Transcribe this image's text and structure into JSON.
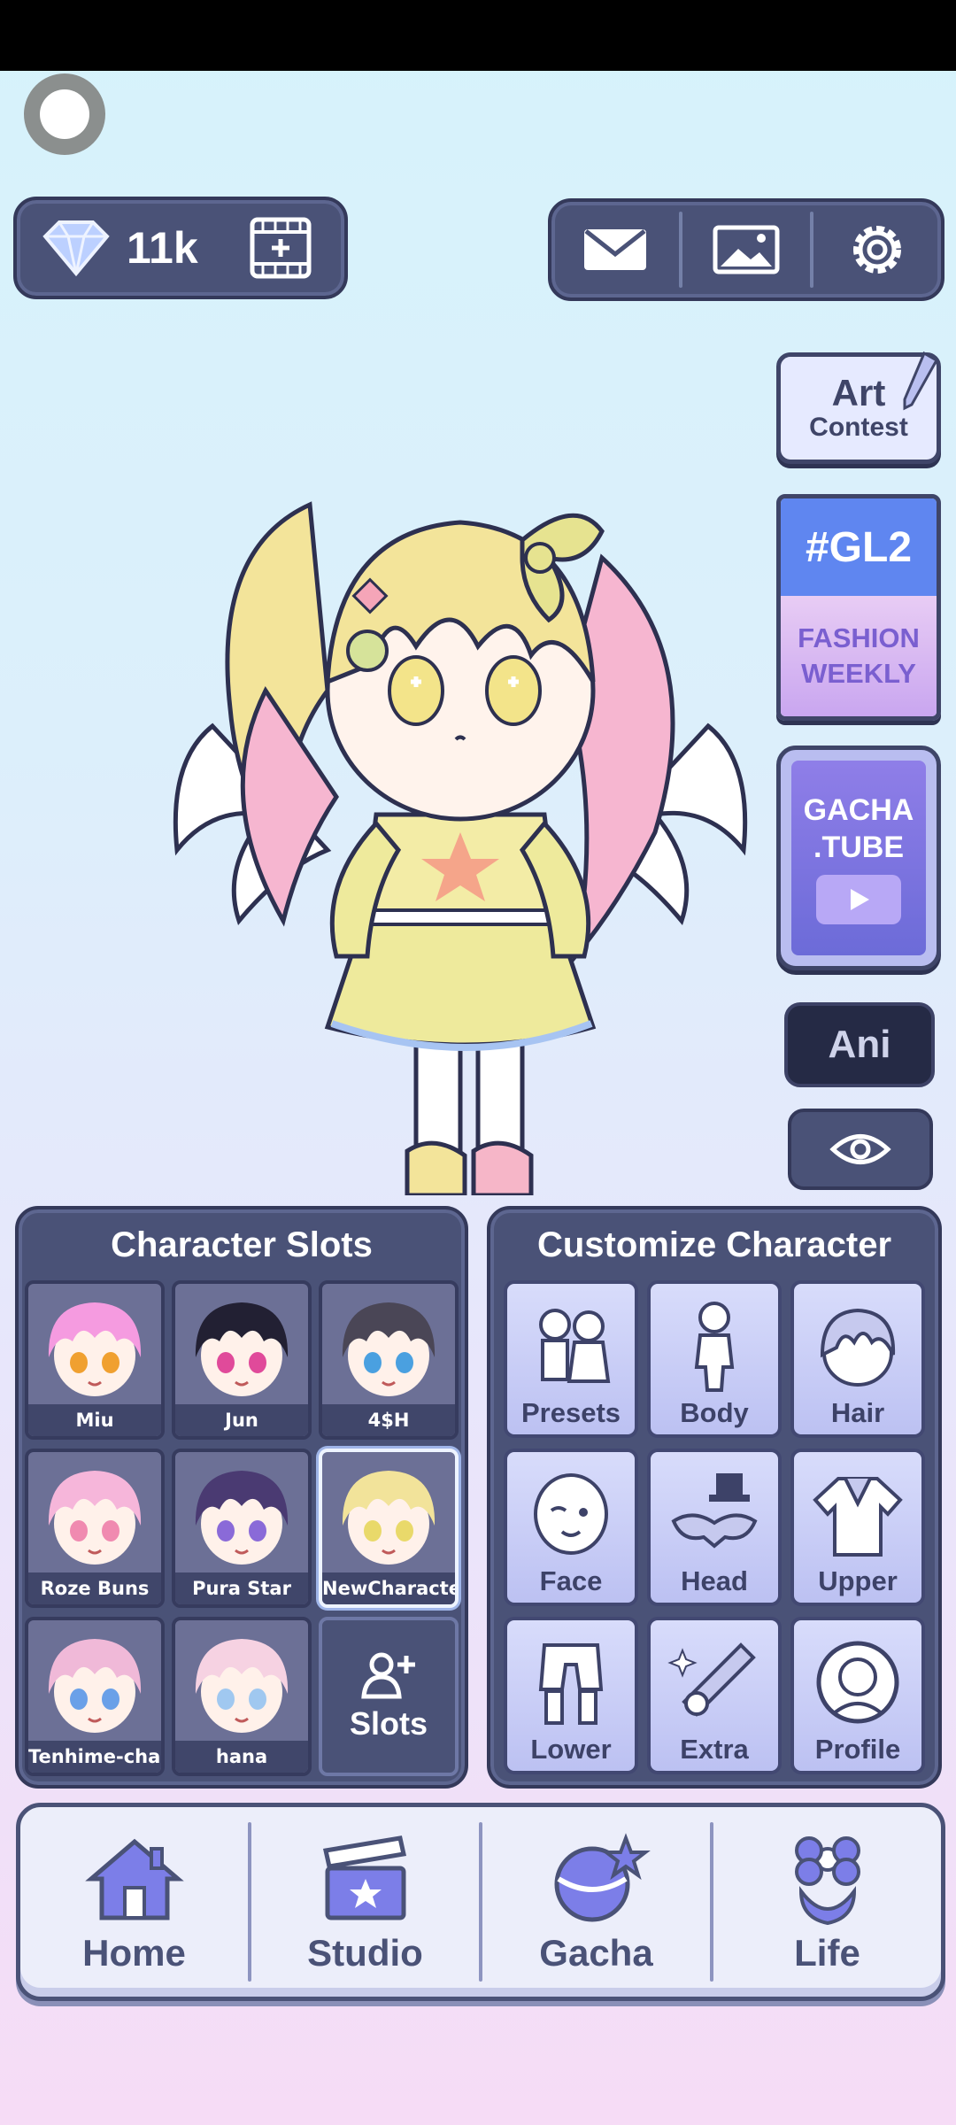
{
  "currency": {
    "gems": "11k"
  },
  "side_buttons": {
    "art_contest": {
      "line1": "Art",
      "line2": "Contest"
    },
    "gl2": {
      "tag": "#GL2",
      "line1": "FASHION",
      "line2": "WEEKLY"
    },
    "gachatube": {
      "line1": "GACHA",
      "line2": ".TUBE"
    },
    "ani": "Ani"
  },
  "slots_panel": {
    "title": "Character Slots",
    "slots": [
      {
        "name": "Miu",
        "hair": "#f59be0",
        "eyes": "#f0a030"
      },
      {
        "name": "Jun",
        "hair": "#222033",
        "eyes": "#e04a9a"
      },
      {
        "name": "4$H",
        "hair": "#4a4656",
        "eyes": "#4aa0e0"
      },
      {
        "name": "Roze Buns",
        "hair": "#f6b6da",
        "eyes": "#f08ab0"
      },
      {
        "name": "Pura Star",
        "hair": "#4a3a72",
        "eyes": "#8a6ad8"
      },
      {
        "name": "NewCharacte",
        "hair": "#f2e39a",
        "eyes": "#e9d96a"
      },
      {
        "name": "Tenhime-char",
        "hair": "#f0b9d8",
        "eyes": "#6aa0e8"
      },
      {
        "name": "hana",
        "hair": "#f6d2e2",
        "eyes": "#a0c8f0"
      }
    ],
    "add_label": "Slots"
  },
  "customize_panel": {
    "title": "Customize Character",
    "items": [
      "Presets",
      "Body",
      "Hair",
      "Face",
      "Head",
      "Upper",
      "Lower",
      "Extra",
      "Profile"
    ]
  },
  "bottom_nav": {
    "items": [
      "Home",
      "Studio",
      "Gacha",
      "Life"
    ]
  },
  "colors": {
    "panel": "#4a5277",
    "accent": "#6c6bd8"
  }
}
